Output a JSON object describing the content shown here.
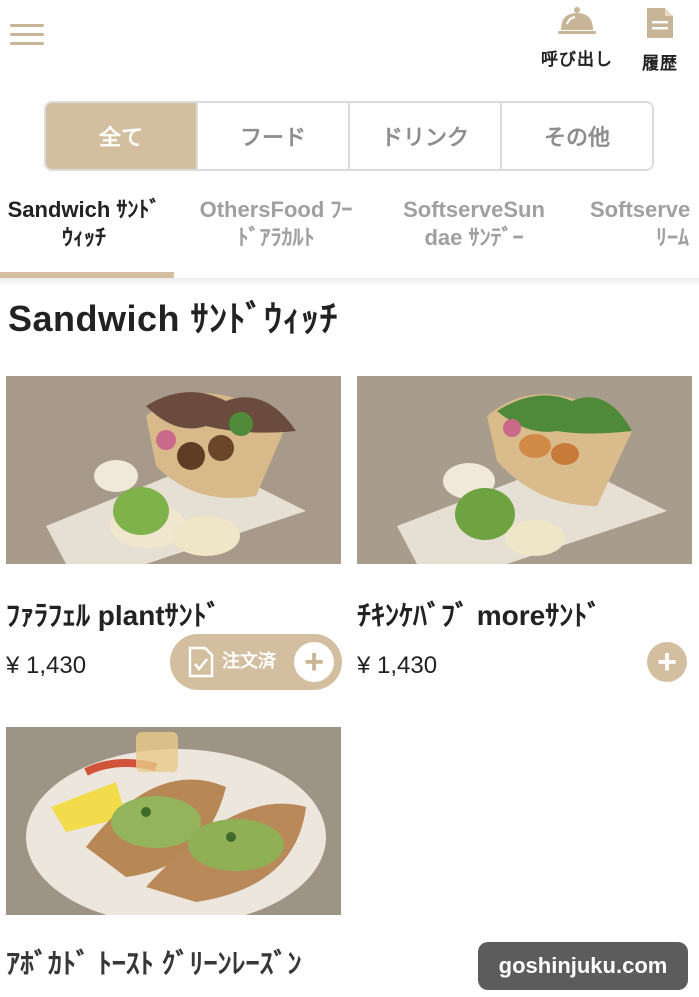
{
  "header": {
    "call_label": "呼び出し",
    "history_label": "履歴"
  },
  "segments": [
    "全て",
    "フード",
    "ドリンク",
    "その他"
  ],
  "category_tabs": [
    {
      "line1": "Sandwich ｻﾝﾄﾞ",
      "line2": "ｳｨｯﾁ"
    },
    {
      "line1": "OthersFood ﾌｰ",
      "line2": "ﾄﾞｱﾗｶﾙﾄ"
    },
    {
      "line1": "SoftserveSun",
      "line2": "dae ｻﾝﾃﾞｰ"
    },
    {
      "line1": "Softserve",
      "line2": "ﾘｰﾑ"
    }
  ],
  "section": {
    "title": "Sandwich ｻﾝﾄﾞｳｨｯﾁ"
  },
  "products": [
    {
      "name": "ﾌｧﾗﾌｪﾙ plantｻﾝﾄﾞ",
      "price": "¥ 1,430",
      "ordered_label": "注文済"
    },
    {
      "name": "ﾁｷﾝｹﾊﾞﾌﾞ moreｻﾝﾄﾞ",
      "price": "¥ 1,430"
    },
    {
      "name": "ｱﾎﾞｶﾄﾞ ﾄｰｽﾄ ｸﾞﾘｰﾝﾚｰｽﾞﾝ"
    }
  ],
  "add_symbol": "+",
  "watermark": "goshinjuku.com",
  "colors": {
    "accent": "#d3bf9f",
    "text": "#222222",
    "muted": "#a0a0a0"
  }
}
